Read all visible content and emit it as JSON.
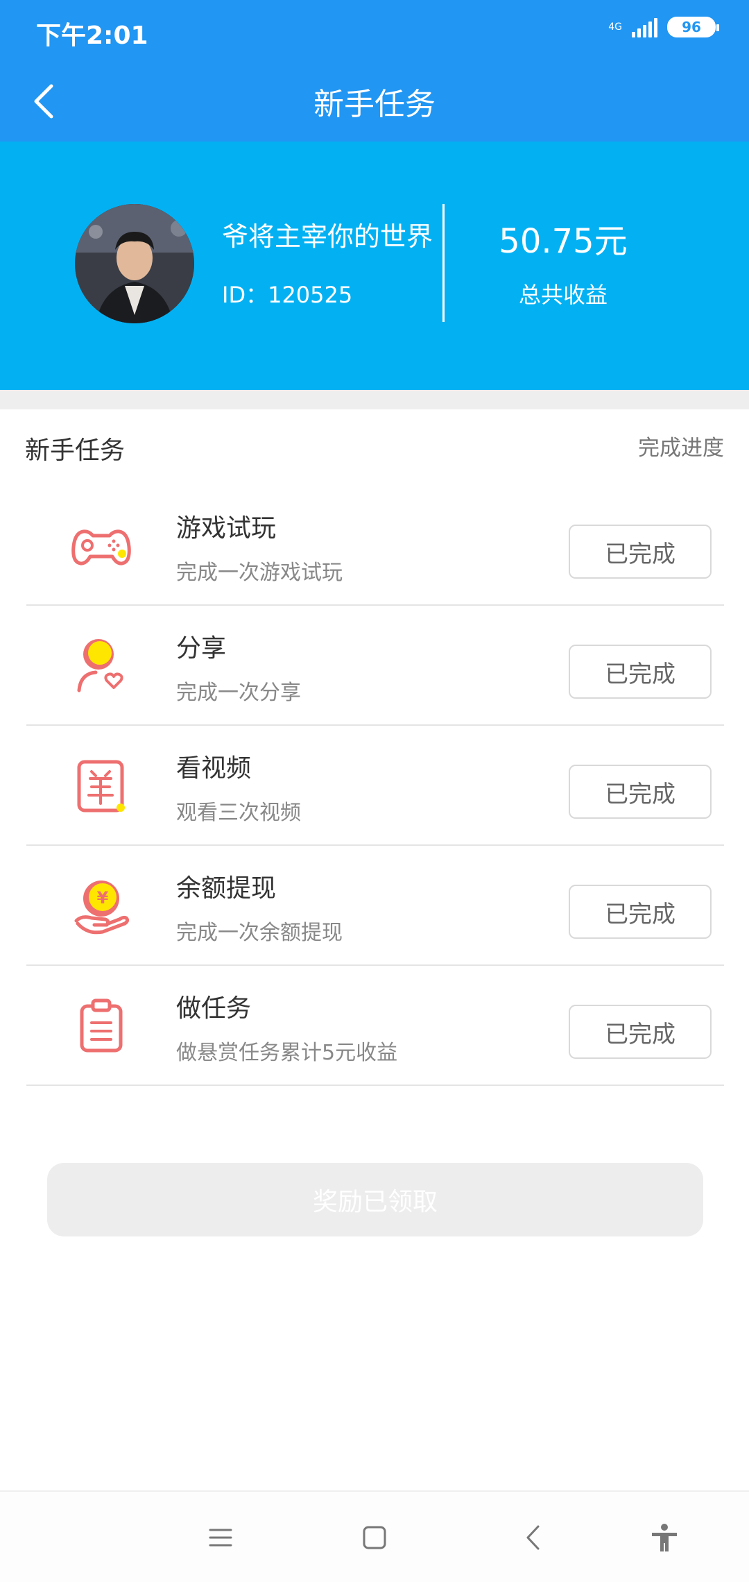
{
  "status_bar": {
    "time": "下午2:01",
    "network": "4G",
    "battery": "96"
  },
  "nav": {
    "title": "新手任务",
    "back_icon": "chevron-left-icon"
  },
  "profile": {
    "username": "爷将主宰你的世界",
    "user_id": "ID：120525",
    "earnings_value": "50.75元",
    "earnings_label": "总共收益"
  },
  "section": {
    "title": "新手任务",
    "progress_label": "完成进度"
  },
  "tasks": [
    {
      "icon": "gamepad-icon",
      "title": "游戏试玩",
      "desc": "完成一次游戏试玩",
      "status": "已完成"
    },
    {
      "icon": "share-user-icon",
      "title": "分享",
      "desc": "完成一次分享",
      "status": "已完成"
    },
    {
      "icon": "video-icon",
      "title": "看视频",
      "desc": "观看三次视频",
      "status": "已完成"
    },
    {
      "icon": "withdraw-coin-icon",
      "title": "余额提现",
      "desc": "完成一次余额提现",
      "status": "已完成"
    },
    {
      "icon": "clipboard-icon",
      "title": "做任务",
      "desc": "做悬赏任务累计5元收益",
      "status": "已完成"
    }
  ],
  "reward_button": "奖励已领取",
  "colors": {
    "header_blue": "#2196f3",
    "profile_blue": "#03b1f3",
    "icon_red": "#ee6f6f",
    "icon_yellow": "#ffe600"
  }
}
